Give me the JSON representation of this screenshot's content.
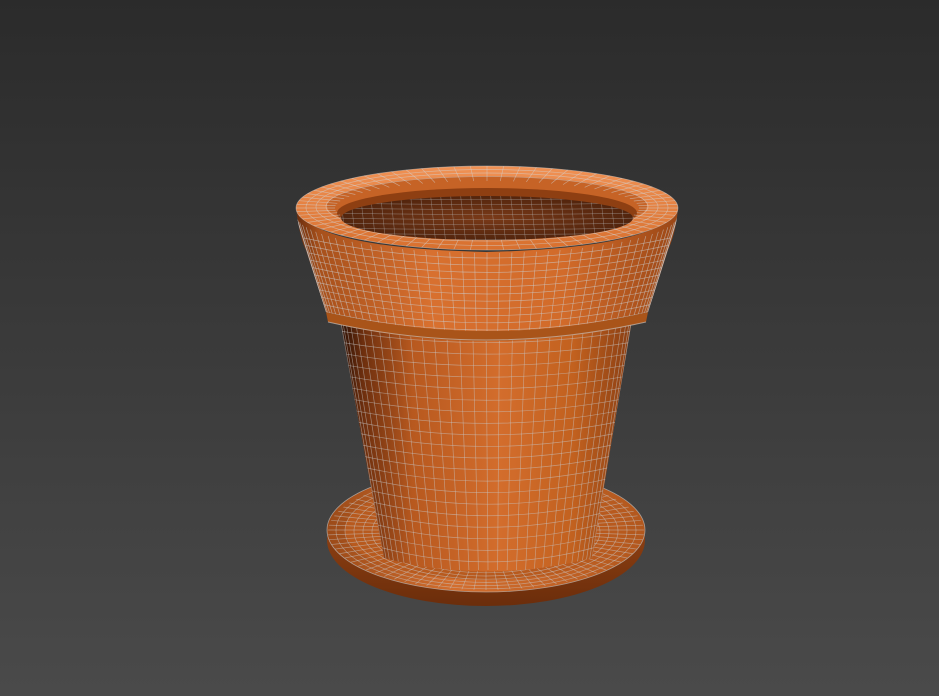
{
  "viewport": {
    "background_top": "#2b2b2b",
    "background_bottom": "#4a4a4a",
    "object": {
      "name": "flower-pot",
      "display_mode": "shaded-with-wireframe",
      "base_color": "#c8642a",
      "highlight_color": "#e9823e",
      "shadow_color": "#7a3512",
      "wire_color": "#b3b3b3",
      "parts": [
        "rim",
        "body",
        "saucer",
        "soil-surface"
      ]
    }
  }
}
